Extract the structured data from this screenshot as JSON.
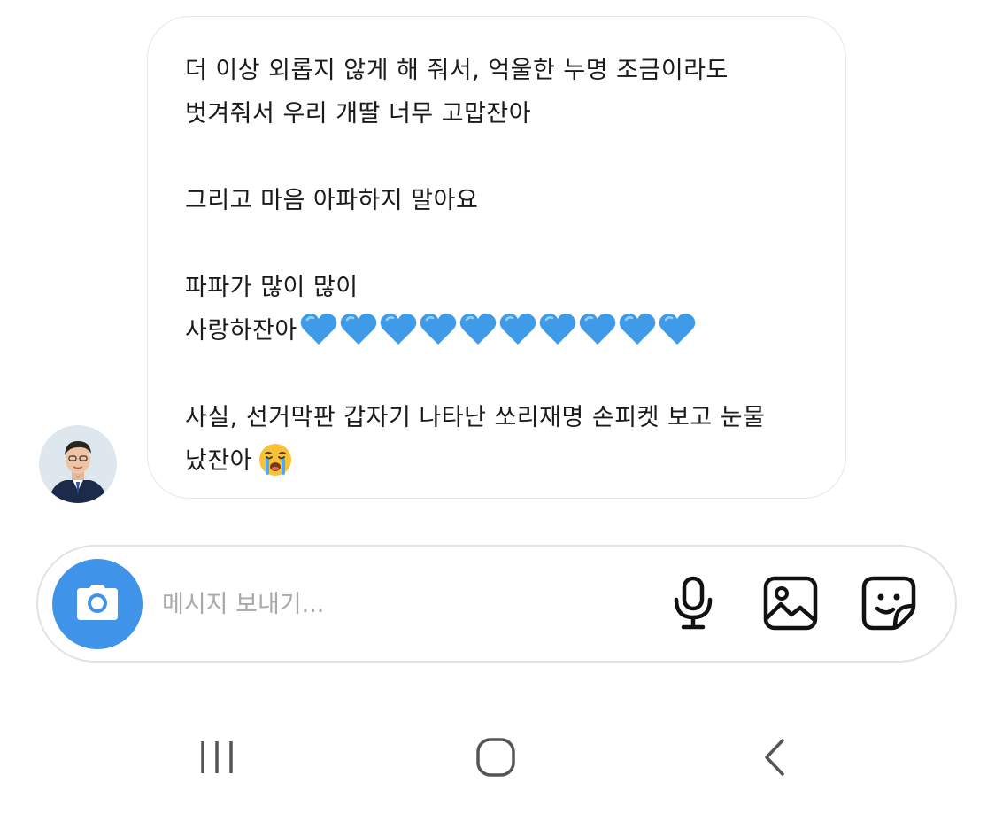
{
  "message": {
    "lines": [
      "더 이상 외롭지 않게 해 줘서, 억울한 누명 조금이라도",
      "벗겨줘서 우리 개딸 너무 고맙잔아",
      "",
      "그리고 마음 아파하지 말아요",
      "",
      "파파가 많이 많이",
      "사랑하잔아",
      "",
      "사실, 선거막판 갑자기 나타난 쏘리재명 손피켓 보고 눈물",
      "났잔아"
    ],
    "heart_count": 10,
    "heart_color": "#3f9be8",
    "emoji": "loudly-crying-face"
  },
  "input": {
    "placeholder": "메시지 보내기...",
    "value": ""
  },
  "colors": {
    "camera_button": "#3f93e8",
    "bubble_border": "#e6e6e6",
    "placeholder": "#a9a9a9"
  },
  "icons": {
    "camera": "camera-icon",
    "mic": "microphone-icon",
    "gallery": "gallery-icon",
    "sticker": "sticker-icon",
    "nav_recent": "recent-apps-icon",
    "nav_home": "home-icon",
    "nav_back": "back-icon"
  }
}
